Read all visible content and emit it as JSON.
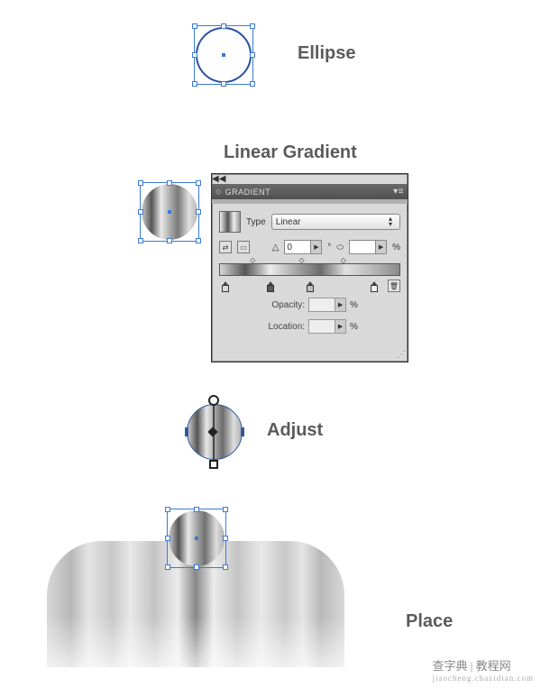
{
  "steps": {
    "ellipse_label": "Ellipse",
    "linear_gradient_label": "Linear Gradient",
    "adjust_label": "Adjust",
    "place_label": "Place"
  },
  "gradient_panel": {
    "title": "Gradient",
    "type_label": "Type",
    "type_value": "Linear",
    "angle_value": "0",
    "angle_unit_deg": "°",
    "aspect_unit": "%",
    "opacity_label": "Opacity:",
    "opacity_unit": "%",
    "location_label": "Location:",
    "location_unit": "%",
    "stops": [
      {
        "position_pct": 3,
        "color": "#d8d8d8"
      },
      {
        "position_pct": 28,
        "color": "#5a5a5a"
      },
      {
        "position_pct": 50,
        "color": "#bfbfbf"
      },
      {
        "position_pct": 86,
        "color": "#efefef"
      }
    ],
    "midpoints_pct": [
      18,
      45,
      68
    ]
  },
  "watermark": {
    "main": "查字典 | 教程网",
    "sub": "jiaocheng.chazidian.com"
  }
}
